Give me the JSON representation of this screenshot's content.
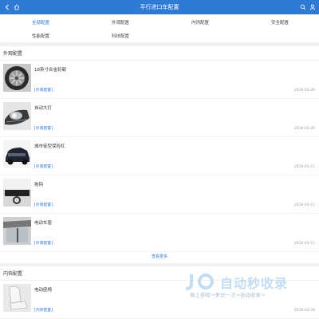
{
  "header": {
    "title": "平行进口车配置",
    "icons": [
      "back-icon",
      "home-icon",
      "search-icon",
      "user-icon"
    ]
  },
  "categories": [
    {
      "label": "全部配置",
      "active": true
    },
    {
      "label": "外观配置",
      "active": false
    },
    {
      "label": "内饰配置",
      "active": false
    },
    {
      "label": "安全配置",
      "active": false
    },
    {
      "label": "性能配置",
      "active": false
    },
    {
      "label": "科技配置",
      "active": false
    }
  ],
  "exterior": {
    "heading": "外观配置",
    "items": [
      {
        "title": "18英寸合金轮毂",
        "tag": "[外观配置]",
        "date": "2019-03-20"
      },
      {
        "title": "自动大灯",
        "tag": "[外观配置]",
        "date": "2019-03-20"
      },
      {
        "title": "城市徒型保险杠",
        "tag": "[外观配置]",
        "date": "2019-03-11"
      },
      {
        "title": "拖钩",
        "tag": "[外观配置]",
        "date": "2019-03-11"
      },
      {
        "title": "电动车窗",
        "tag": "[外观配置]",
        "date": "2019-03-11"
      }
    ],
    "more": "查看更多"
  },
  "interior": {
    "heading": "内饰配置",
    "items": [
      {
        "title": "电动座椅",
        "tag": "[内饰配置]",
        "date": "2019-03-20"
      }
    ]
  },
  "watermark": {
    "text": "自动秒收录",
    "sub": "做上排榜→来访一次→自动收录→"
  },
  "colors": {
    "accent": "#2e7bd6",
    "background": "#f2f2f2"
  }
}
